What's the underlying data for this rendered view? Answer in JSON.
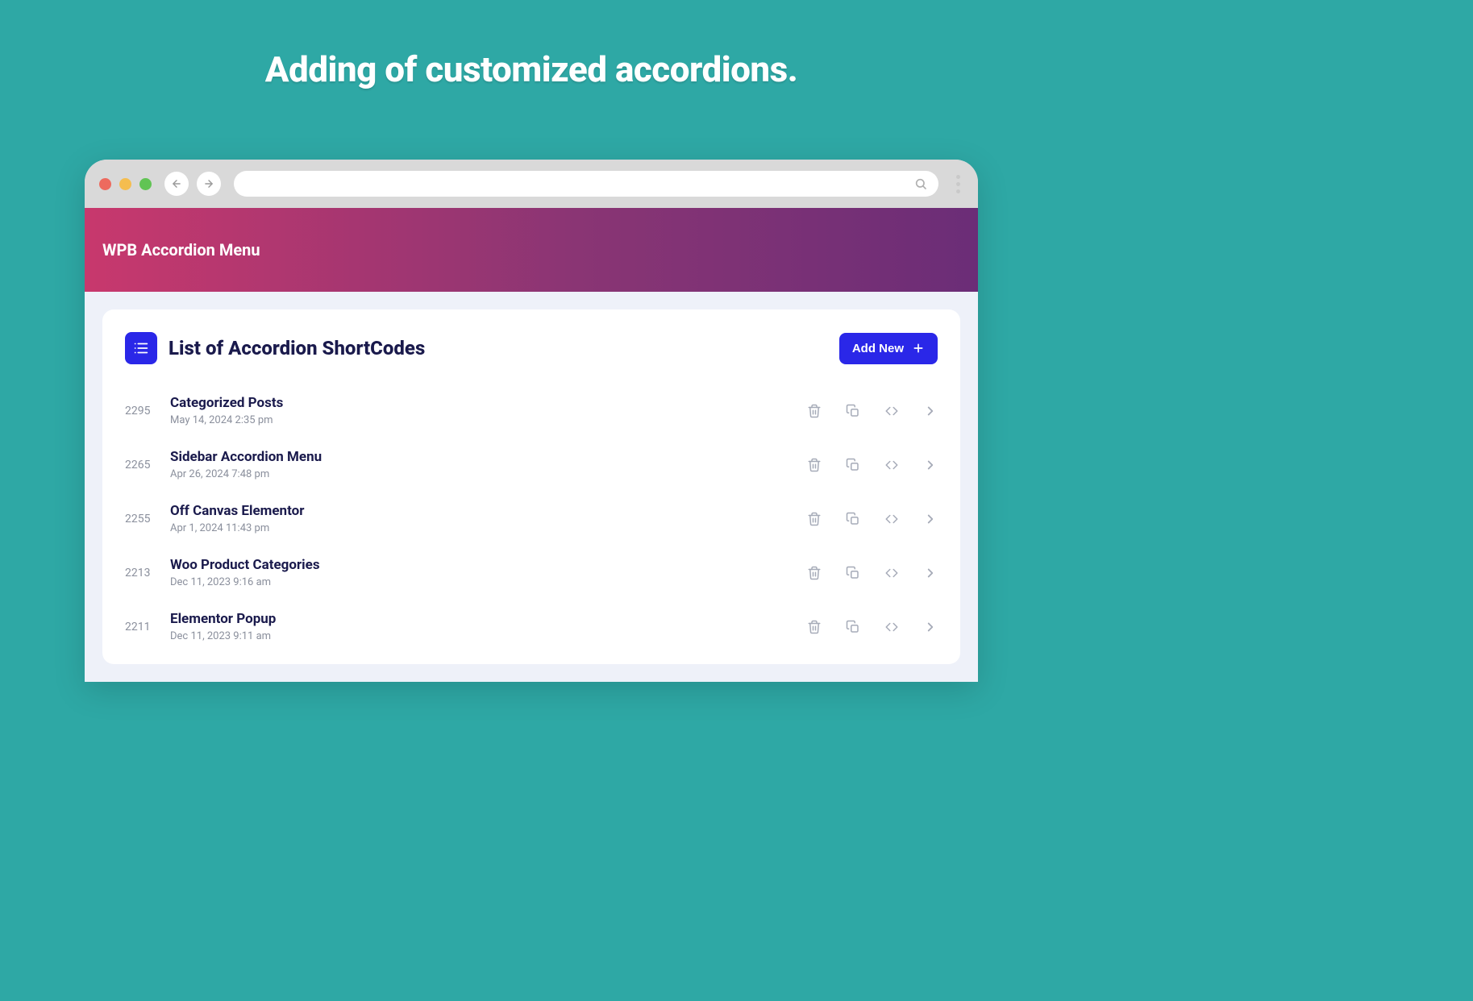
{
  "page_heading": "Adding of customized accordions.",
  "plugin_bar": {
    "title": "WPB Accordion Menu"
  },
  "card": {
    "title": "List of Accordion ShortCodes",
    "add_label": "Add New"
  },
  "rows": [
    {
      "id": "2295",
      "name": "Categorized Posts",
      "date": "May 14, 2024 2:35 pm"
    },
    {
      "id": "2265",
      "name": "Sidebar Accordion Menu",
      "date": "Apr 26, 2024 7:48 pm"
    },
    {
      "id": "2255",
      "name": "Off Canvas Elementor",
      "date": "Apr 1, 2024 11:43 pm"
    },
    {
      "id": "2213",
      "name": "Woo Product Categories",
      "date": "Dec 11, 2023 9:16 am"
    },
    {
      "id": "2211",
      "name": "Elementor Popup",
      "date": "Dec 11, 2023 9:11 am"
    }
  ]
}
